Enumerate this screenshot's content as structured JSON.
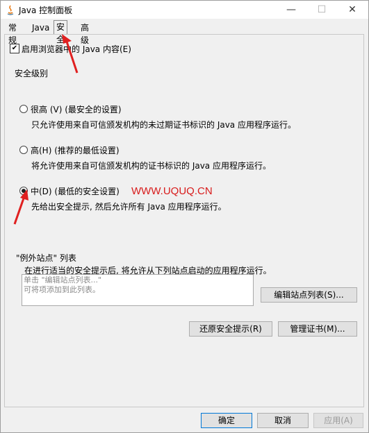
{
  "window": {
    "title": "Java 控制面板",
    "minimize": "—",
    "maximize": "☐",
    "close": "✕"
  },
  "tabs": [
    "常规",
    "Java",
    "安全",
    "高级"
  ],
  "security": {
    "enable_browser_java": "启用浏览器中的 Java 内容(E)",
    "level_heading": "安全级别",
    "very_high": {
      "label": "很高 (V) (最安全的设置)",
      "desc": "只允许使用来自可信颁发机构的未过期证书标识的 Java 应用程序运行。"
    },
    "high": {
      "label": "高(H) (推荐的最低设置)",
      "desc": "将允许使用来自可信颁发机构的证书标识的 Java 应用程序运行。"
    },
    "medium": {
      "label": "中(D) (最低的安全设置)",
      "desc": "先给出安全提示, 然后允许所有 Java 应用程序运行。"
    },
    "selected": "medium"
  },
  "exception": {
    "heading": "\"例外站点\" 列表",
    "desc": "在进行适当的安全提示后, 将允许从下列站点启动的应用程序运行。",
    "placeholder_line1": "单击 \"编辑站点列表...\"",
    "placeholder_line2": "可将项添加到此列表。",
    "edit_button": "编辑站点列表(S)..."
  },
  "buttons": {
    "restore": "还原安全提示(R)",
    "manage_certs": "管理证书(M)...",
    "ok": "确定",
    "cancel": "取消",
    "apply": "应用(A)"
  },
  "watermark": "WWW.UQUQ.CN",
  "colors": {
    "accent": "#0078d7",
    "annotation": "#e02020"
  }
}
